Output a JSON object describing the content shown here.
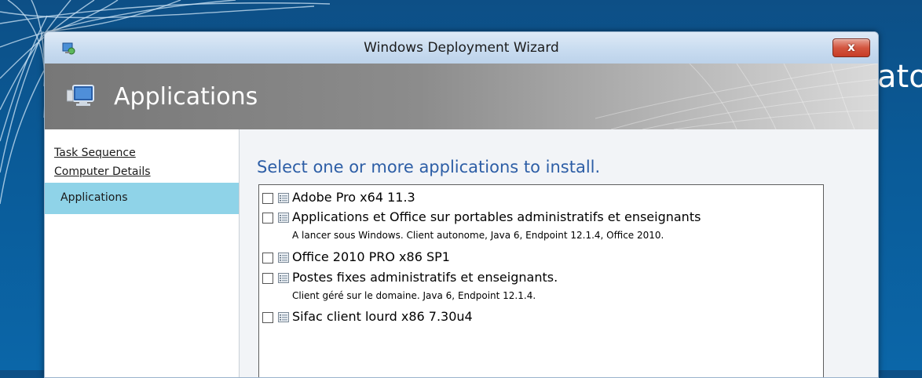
{
  "desktop": {
    "background_text": "ator"
  },
  "window": {
    "title": "Windows Deployment Wizard",
    "close_label": "x"
  },
  "header": {
    "title": "Applications"
  },
  "sidebar": {
    "items": [
      {
        "label": "Task Sequence",
        "state": "link"
      },
      {
        "label": "Computer Details",
        "state": "link"
      },
      {
        "label": "Applications",
        "state": "active"
      }
    ]
  },
  "main": {
    "heading": "Select one or more applications to install.",
    "applications": [
      {
        "name": "Adobe Pro x64 11.3",
        "description": "",
        "checked": false
      },
      {
        "name": "Applications et Office sur portables administratifs et enseignants",
        "description": "A lancer sous Windows. Client autonome, Java 6, Endpoint 12.1.4, Office 2010.",
        "checked": false
      },
      {
        "name": "Office 2010 PRO x86 SP1",
        "description": "",
        "checked": false
      },
      {
        "name": "Postes fixes administratifs et enseignants.",
        "description": "Client géré sur le domaine. Java 6, Endpoint 12.1.4.",
        "checked": false
      },
      {
        "name": "Sifac client lourd x86 7.30u4",
        "description": "",
        "checked": false
      }
    ]
  },
  "colors": {
    "accent": "#2d5ea6",
    "active_nav": "#8fd3e8",
    "close_button": "#c73d26"
  }
}
